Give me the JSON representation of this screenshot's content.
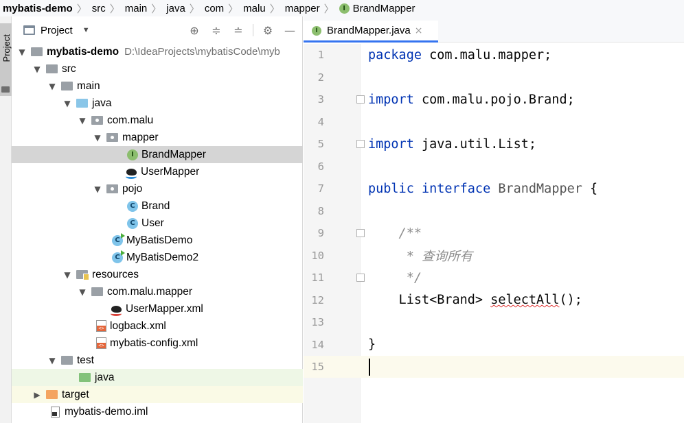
{
  "breadcrumb": [
    "mybatis-demo",
    "src",
    "main",
    "java",
    "com",
    "malu",
    "mapper",
    "BrandMapper"
  ],
  "stripe": {
    "label": "Project"
  },
  "project_panel": {
    "title": "Project",
    "toolbar_icons": [
      "locate-icon",
      "expand-all-icon",
      "collapse-all-icon",
      "gear-icon",
      "minimize-icon"
    ],
    "tree": [
      {
        "label": "mybatis-demo",
        "path": "D:\\IdeaProjects\\mybatisCode\\myb",
        "icon": "module-folder-icon",
        "depth": 0,
        "arrow": "down"
      },
      {
        "label": "src",
        "icon": "folder-icon",
        "depth": 1,
        "arrow": "down"
      },
      {
        "label": "main",
        "icon": "folder-icon",
        "depth": 2,
        "arrow": "down"
      },
      {
        "label": "java",
        "icon": "source-folder-icon",
        "depth": 3,
        "arrow": "down"
      },
      {
        "label": "com.malu",
        "icon": "package-icon",
        "depth": 4,
        "arrow": "down"
      },
      {
        "label": "mapper",
        "icon": "package-icon",
        "depth": 5,
        "arrow": "down"
      },
      {
        "label": "BrandMapper",
        "icon": "interface-icon",
        "depth": 6,
        "selected": true
      },
      {
        "label": "UserMapper",
        "icon": "mybatis-icon",
        "depth": 6
      },
      {
        "label": "pojo",
        "icon": "package-icon",
        "depth": 5,
        "arrow": "down"
      },
      {
        "label": "Brand",
        "icon": "class-icon",
        "depth": 6
      },
      {
        "label": "User",
        "icon": "class-icon",
        "depth": 6
      },
      {
        "label": "MyBatisDemo",
        "icon": "runnable-class-icon",
        "depth": 5
      },
      {
        "label": "MyBatisDemo2",
        "icon": "runnable-class-icon",
        "depth": 5
      },
      {
        "label": "resources",
        "icon": "resources-folder-icon",
        "depth": 3,
        "arrow": "down"
      },
      {
        "label": "com.malu.mapper",
        "icon": "folder-icon",
        "depth": 4,
        "arrow": "down"
      },
      {
        "label": "UserMapper.xml",
        "icon": "mybatis-xml-icon",
        "depth": 5
      },
      {
        "label": "logback.xml",
        "icon": "xml-file-icon",
        "depth": 4
      },
      {
        "label": "mybatis-config.xml",
        "icon": "xml-file-icon",
        "depth": 4
      },
      {
        "label": "test",
        "icon": "folder-icon",
        "depth": 2,
        "arrow": "down"
      },
      {
        "label": "java",
        "icon": "test-folder-icon",
        "depth": 3,
        "highlight": "green"
      },
      {
        "label": "target",
        "icon": "excluded-folder-icon",
        "depth": 1,
        "arrow": "right",
        "highlight": "yellow"
      },
      {
        "label": "mybatis-demo.iml",
        "icon": "iml-file-icon",
        "depth": 1
      }
    ]
  },
  "editor": {
    "tab_label": "BrandMapper.java",
    "tab_close": "×",
    "line_numbers": [
      "1",
      "2",
      "3",
      "4",
      "5",
      "6",
      "7",
      "8",
      "9",
      "10",
      "11",
      "12",
      "13",
      "14",
      "15"
    ],
    "code": {
      "l1_kw": "package",
      "l1_rest": " com.malu.mapper;",
      "l3_kw": "import",
      "l3_rest": " com.malu.pojo.Brand;",
      "l5_kw": "import",
      "l5_rest": " java.util.List;",
      "l7_kw1": "public",
      "l7_kw2": "interface",
      "l7_type": "BrandMapper",
      "l7_brace": " {",
      "l9": "    /**",
      "l10": "     * 查询所有",
      "l11": "     */",
      "l12_pre": "    List<Brand> ",
      "l12_method": "selectAll",
      "l12_post": "();",
      "l14": "}"
    }
  },
  "colors": {
    "keyword": "#0033b3",
    "comment": "#8c8c8c",
    "accent": "#3574f0",
    "selected_row": "#d5d5d5"
  }
}
